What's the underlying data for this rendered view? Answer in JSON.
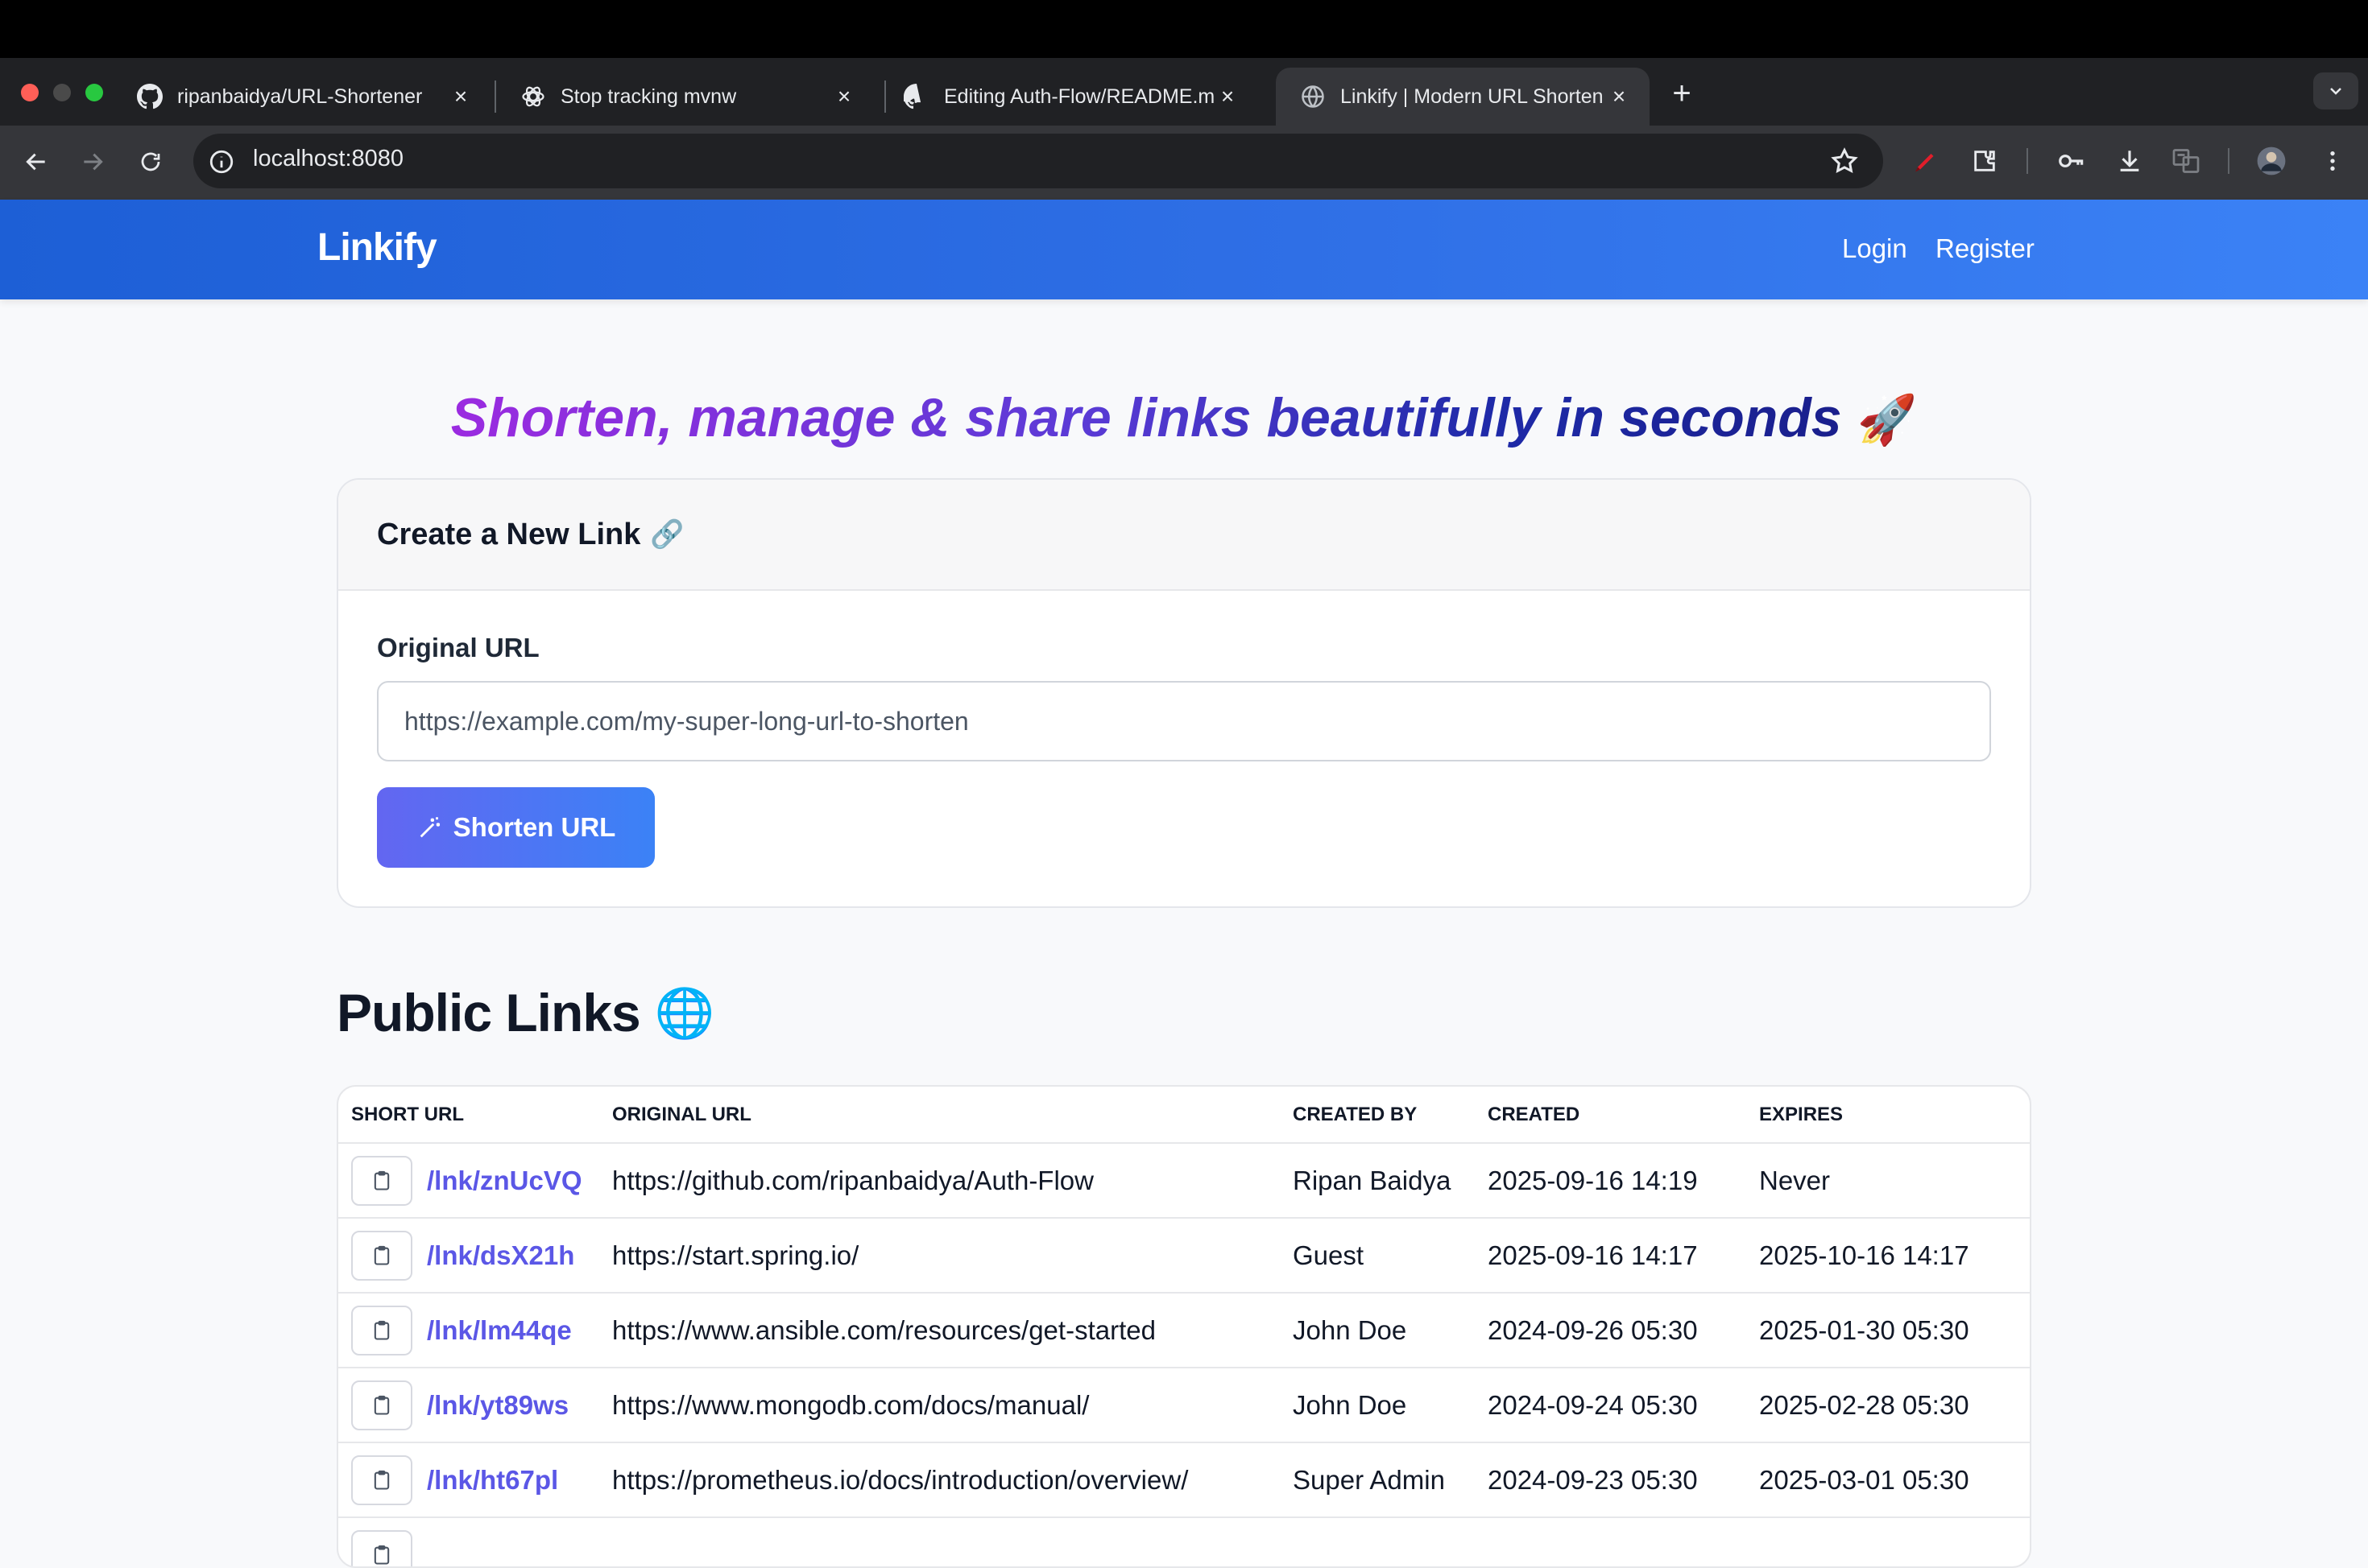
{
  "browser": {
    "tabs": [
      {
        "title": "ripanbaidya/URL-Shortener",
        "icon": "github-icon",
        "active": false
      },
      {
        "title": "Stop tracking mvnw",
        "icon": "openai-icon",
        "active": false
      },
      {
        "title": "Editing Auth-Flow/README.m",
        "icon": "github-icon",
        "active": false
      },
      {
        "title": "Linkify | Modern URL Shorten",
        "icon": "globe-icon",
        "active": true
      }
    ],
    "address": "localhost:8080",
    "colors": {
      "chrome_dark": "#202124",
      "toolbar": "#35363a"
    }
  },
  "site": {
    "brand": "Linkify",
    "nav": {
      "login": "Login",
      "register": "Register"
    },
    "hero": {
      "text": "Shorten, manage & share links beautifully in seconds",
      "emoji": "🚀"
    },
    "create_card": {
      "title": "Create a New Link",
      "title_emoji": "🔗",
      "field_label": "Original URL",
      "placeholder": "https://example.com/my-super-long-url-to-shorten",
      "value": "",
      "button_icon": "magic-wand-icon",
      "button_label": "Shorten URL"
    },
    "public_links": {
      "title": "Public Links",
      "title_emoji": "🌐",
      "columns": [
        "SHORT URL",
        "ORIGINAL URL",
        "CREATED BY",
        "CREATED",
        "EXPIRES"
      ],
      "rows": [
        {
          "short": "/lnk/znUcVQ",
          "original": "https://github.com/ripanbaidya/Auth-Flow",
          "created_by": "Ripan Baidya",
          "created": "2025-09-16 14:19",
          "expires": "Never"
        },
        {
          "short": "/lnk/dsX21h",
          "original": "https://start.spring.io/",
          "created_by": "Guest",
          "created": "2025-09-16 14:17",
          "expires": "2025-10-16 14:17"
        },
        {
          "short": "/lnk/lm44qe",
          "original": "https://www.ansible.com/resources/get-started",
          "created_by": "John Doe",
          "created": "2024-09-26 05:30",
          "expires": "2025-01-30 05:30"
        },
        {
          "short": "/lnk/yt89ws",
          "original": "https://www.mongodb.com/docs/manual/",
          "created_by": "John Doe",
          "created": "2024-09-24 05:30",
          "expires": "2025-02-28 05:30"
        },
        {
          "short": "/lnk/ht67pl",
          "original": "https://prometheus.io/docs/introduction/overview/",
          "created_by": "Super Admin",
          "created": "2024-09-23 05:30",
          "expires": "2025-03-01 05:30"
        }
      ]
    },
    "colors": {
      "header_start": "#1d5fd6",
      "header_end": "#3b82f6",
      "link": "#5b57e6",
      "button_start": "#6366f1",
      "button_end": "#3b82f6"
    }
  }
}
